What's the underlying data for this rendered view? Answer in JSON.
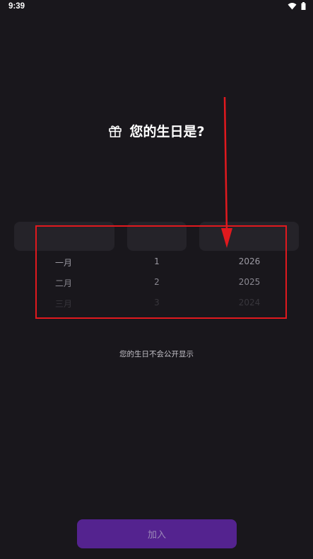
{
  "status_bar": {
    "time": "9:39"
  },
  "title": {
    "icon": "gift-icon",
    "text": "您的生日是?"
  },
  "picker": {
    "months": [
      "一月",
      "二月",
      "三月"
    ],
    "days": [
      "1",
      "2",
      "3"
    ],
    "years": [
      "2026",
      "2025",
      "2024"
    ]
  },
  "privacy_note": "您的生日不会公开显示",
  "join_button": {
    "label": "加入"
  },
  "colors": {
    "background": "#19171c",
    "accent": "#54238f",
    "annotation": "#e0191e"
  }
}
